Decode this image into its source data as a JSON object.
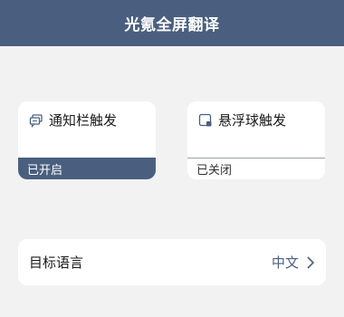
{
  "header": {
    "title": "光氪全屏翻译"
  },
  "cards": {
    "notification": {
      "label": "通知栏触发",
      "status": "已开启",
      "icon": "chat-bubbles-icon"
    },
    "floating_ball": {
      "label": "悬浮球触发",
      "status": "已关闭",
      "icon": "floating-square-icon"
    }
  },
  "target_language": {
    "label": "目标语言",
    "value": "中文",
    "icon": "chevron-right-icon"
  },
  "colors": {
    "accent": "#4a5f7f",
    "background": "#f2f2f2",
    "card": "#ffffff"
  }
}
